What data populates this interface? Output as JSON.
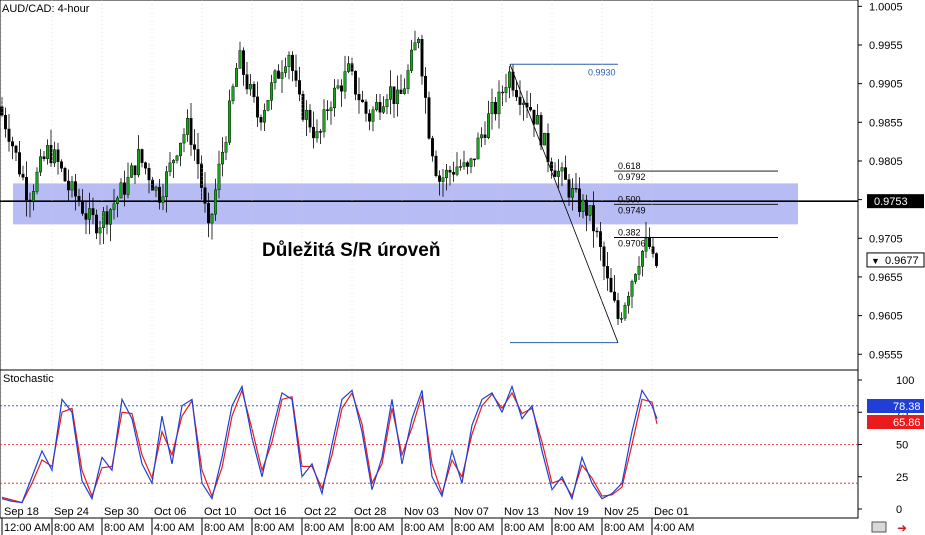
{
  "chart_data": {
    "type": "candlestick",
    "symbol_label": "AUD/CAD: 4-hour",
    "annotation": "Důležitá S/R úroveň",
    "price_axis": {
      "ylim": [
        0.9545,
        1.0008
      ],
      "ticks": [
        "1.0005",
        "0.9955",
        "0.9905",
        "0.9855",
        "0.9805",
        "0.9755",
        "0.9705",
        "0.9655",
        "0.9605",
        "0.9555"
      ]
    },
    "sr_zone": {
      "low": 0.9723,
      "high": 0.9776,
      "color": "#aab2f2"
    },
    "sr_level": {
      "value": 0.9753,
      "label": "0.9753"
    },
    "current_price": {
      "value": 0.9677,
      "label": "0.9677"
    },
    "fib_high": {
      "value": 0.993,
      "label": "0.9930"
    },
    "fib_low": {
      "value": 0.957
    },
    "fib_levels": [
      {
        "ratio": "0.618",
        "value": "0.9792",
        "price": 0.9792
      },
      {
        "ratio": "0.500",
        "value": "0.9749",
        "price": 0.9749
      },
      {
        "ratio": "0.382",
        "value": "0.9706",
        "price": 0.9706
      }
    ],
    "date_labels": [
      "Sep 18",
      "Sep 24",
      "Sep 30",
      "Oct 06",
      "Oct 10",
      "Oct 16",
      "Oct 22",
      "Oct 28",
      "Nov 03",
      "Nov 07",
      "Nov 13",
      "Nov 19",
      "Nov 25",
      "Dec 01"
    ],
    "time_labels": [
      "12:00 AM",
      "8:00 AM",
      "8:00 AM",
      "4:00 AM",
      "8:00 AM",
      "8:00 AM",
      "8:00 AM",
      "8:00 AM",
      "8:00 AM",
      "8:00 AM",
      "8:00 AM",
      "8:00 AM",
      "8:00 AM",
      "4:00 AM"
    ],
    "price_path": [
      [
        0,
        0.9875
      ],
      [
        10,
        0.9845
      ],
      [
        20,
        0.98
      ],
      [
        30,
        0.976
      ],
      [
        40,
        0.979
      ],
      [
        50,
        0.982
      ],
      [
        60,
        0.98
      ],
      [
        70,
        0.977
      ],
      [
        80,
        0.9755
      ],
      [
        90,
        0.973
      ],
      [
        100,
        0.9725
      ],
      [
        110,
        0.974
      ],
      [
        120,
        0.976
      ],
      [
        130,
        0.978
      ],
      [
        140,
        0.981
      ],
      [
        150,
        0.979
      ],
      [
        160,
        0.976
      ],
      [
        170,
        0.979
      ],
      [
        180,
        0.983
      ],
      [
        190,
        0.985
      ],
      [
        200,
        0.98
      ],
      [
        210,
        0.971
      ],
      [
        220,
        0.979
      ],
      [
        230,
        0.986
      ],
      [
        240,
        0.994
      ],
      [
        250,
        0.99
      ],
      [
        260,
        0.986
      ],
      [
        270,
        0.989
      ],
      [
        280,
        0.992
      ],
      [
        290,
        0.995
      ],
      [
        300,
        0.988
      ],
      [
        310,
        0.986
      ],
      [
        320,
        0.983
      ],
      [
        330,
        0.988
      ],
      [
        340,
        0.99
      ],
      [
        350,
        0.992
      ],
      [
        360,
        0.989
      ],
      [
        370,
        0.986
      ],
      [
        380,
        0.988
      ],
      [
        390,
        0.99
      ],
      [
        400,
        0.988
      ],
      [
        410,
        0.992
      ],
      [
        420,
        0.997
      ],
      [
        430,
        0.985
      ],
      [
        440,
        0.978
      ],
      [
        450,
        0.979
      ],
      [
        460,
        0.98
      ],
      [
        470,
        0.979
      ],
      [
        480,
        0.983
      ],
      [
        490,
        0.986
      ],
      [
        500,
        0.988
      ],
      [
        510,
        0.992
      ],
      [
        520,
        0.9895
      ],
      [
        530,
        0.988
      ],
      [
        540,
        0.985
      ],
      [
        550,
        0.981
      ],
      [
        560,
        0.979
      ],
      [
        570,
        0.977
      ],
      [
        580,
        0.975
      ],
      [
        590,
        0.974
      ],
      [
        600,
        0.97
      ],
      [
        610,
        0.964
      ],
      [
        620,
        0.96
      ],
      [
        630,
        0.964
      ],
      [
        640,
        0.968
      ],
      [
        650,
        0.97
      ],
      [
        655,
        0.967
      ]
    ],
    "stochastic": {
      "label": "Stochastic",
      "ylim": [
        0,
        100
      ],
      "ticks": [
        "100",
        "75",
        "50",
        "25",
        "0"
      ],
      "levels": [
        80,
        50,
        20
      ],
      "k_label": "78.38",
      "d_label": "65.86",
      "k_color": "#1f3fd6",
      "d_color": "#e81c1c",
      "k_path": [
        [
          0,
          8
        ],
        [
          10,
          6
        ],
        [
          20,
          5
        ],
        [
          30,
          25
        ],
        [
          40,
          45
        ],
        [
          50,
          30
        ],
        [
          60,
          85
        ],
        [
          70,
          75
        ],
        [
          80,
          22
        ],
        [
          90,
          8
        ],
        [
          100,
          40
        ],
        [
          110,
          30
        ],
        [
          120,
          85
        ],
        [
          130,
          70
        ],
        [
          140,
          35
        ],
        [
          150,
          20
        ],
        [
          160,
          72
        ],
        [
          170,
          35
        ],
        [
          180,
          80
        ],
        [
          190,
          85
        ],
        [
          200,
          20
        ],
        [
          210,
          8
        ],
        [
          220,
          40
        ],
        [
          230,
          80
        ],
        [
          240,
          95
        ],
        [
          250,
          55
        ],
        [
          260,
          25
        ],
        [
          270,
          60
        ],
        [
          280,
          90
        ],
        [
          290,
          85
        ],
        [
          300,
          25
        ],
        [
          310,
          35
        ],
        [
          320,
          12
        ],
        [
          330,
          50
        ],
        [
          340,
          85
        ],
        [
          350,
          92
        ],
        [
          360,
          60
        ],
        [
          370,
          15
        ],
        [
          380,
          40
        ],
        [
          390,
          85
        ],
        [
          400,
          35
        ],
        [
          410,
          70
        ],
        [
          420,
          92
        ],
        [
          430,
          25
        ],
        [
          440,
          10
        ],
        [
          450,
          45
        ],
        [
          460,
          20
        ],
        [
          470,
          65
        ],
        [
          480,
          85
        ],
        [
          490,
          90
        ],
        [
          500,
          75
        ],
        [
          510,
          95
        ],
        [
          520,
          70
        ],
        [
          530,
          80
        ],
        [
          540,
          45
        ],
        [
          550,
          15
        ],
        [
          560,
          25
        ],
        [
          570,
          8
        ],
        [
          580,
          40
        ],
        [
          590,
          20
        ],
        [
          600,
          8
        ],
        [
          610,
          12
        ],
        [
          620,
          20
        ],
        [
          630,
          60
        ],
        [
          640,
          92
        ],
        [
          650,
          80
        ],
        [
          655,
          70
        ]
      ],
      "d_path": [
        [
          0,
          9
        ],
        [
          10,
          7
        ],
        [
          20,
          5
        ],
        [
          30,
          20
        ],
        [
          40,
          38
        ],
        [
          50,
          33
        ],
        [
          60,
          75
        ],
        [
          70,
          78
        ],
        [
          80,
          30
        ],
        [
          90,
          10
        ],
        [
          100,
          32
        ],
        [
          110,
          33
        ],
        [
          120,
          75
        ],
        [
          130,
          74
        ],
        [
          140,
          42
        ],
        [
          150,
          24
        ],
        [
          160,
          60
        ],
        [
          170,
          42
        ],
        [
          180,
          72
        ],
        [
          190,
          84
        ],
        [
          200,
          30
        ],
        [
          210,
          10
        ],
        [
          220,
          32
        ],
        [
          230,
          72
        ],
        [
          240,
          92
        ],
        [
          250,
          62
        ],
        [
          260,
          30
        ],
        [
          270,
          52
        ],
        [
          280,
          85
        ],
        [
          290,
          87
        ],
        [
          300,
          33
        ],
        [
          310,
          33
        ],
        [
          320,
          16
        ],
        [
          330,
          42
        ],
        [
          340,
          78
        ],
        [
          350,
          90
        ],
        [
          360,
          66
        ],
        [
          370,
          20
        ],
        [
          380,
          35
        ],
        [
          390,
          78
        ],
        [
          400,
          42
        ],
        [
          410,
          63
        ],
        [
          420,
          88
        ],
        [
          430,
          35
        ],
        [
          440,
          12
        ],
        [
          450,
          38
        ],
        [
          460,
          25
        ],
        [
          470,
          58
        ],
        [
          480,
          80
        ],
        [
          490,
          89
        ],
        [
          500,
          78
        ],
        [
          510,
          90
        ],
        [
          520,
          74
        ],
        [
          530,
          78
        ],
        [
          540,
          52
        ],
        [
          550,
          20
        ],
        [
          560,
          23
        ],
        [
          570,
          10
        ],
        [
          580,
          34
        ],
        [
          590,
          24
        ],
        [
          600,
          10
        ],
        [
          610,
          11
        ],
        [
          620,
          17
        ],
        [
          630,
          50
        ],
        [
          640,
          85
        ],
        [
          650,
          83
        ],
        [
          655,
          66
        ]
      ]
    }
  }
}
